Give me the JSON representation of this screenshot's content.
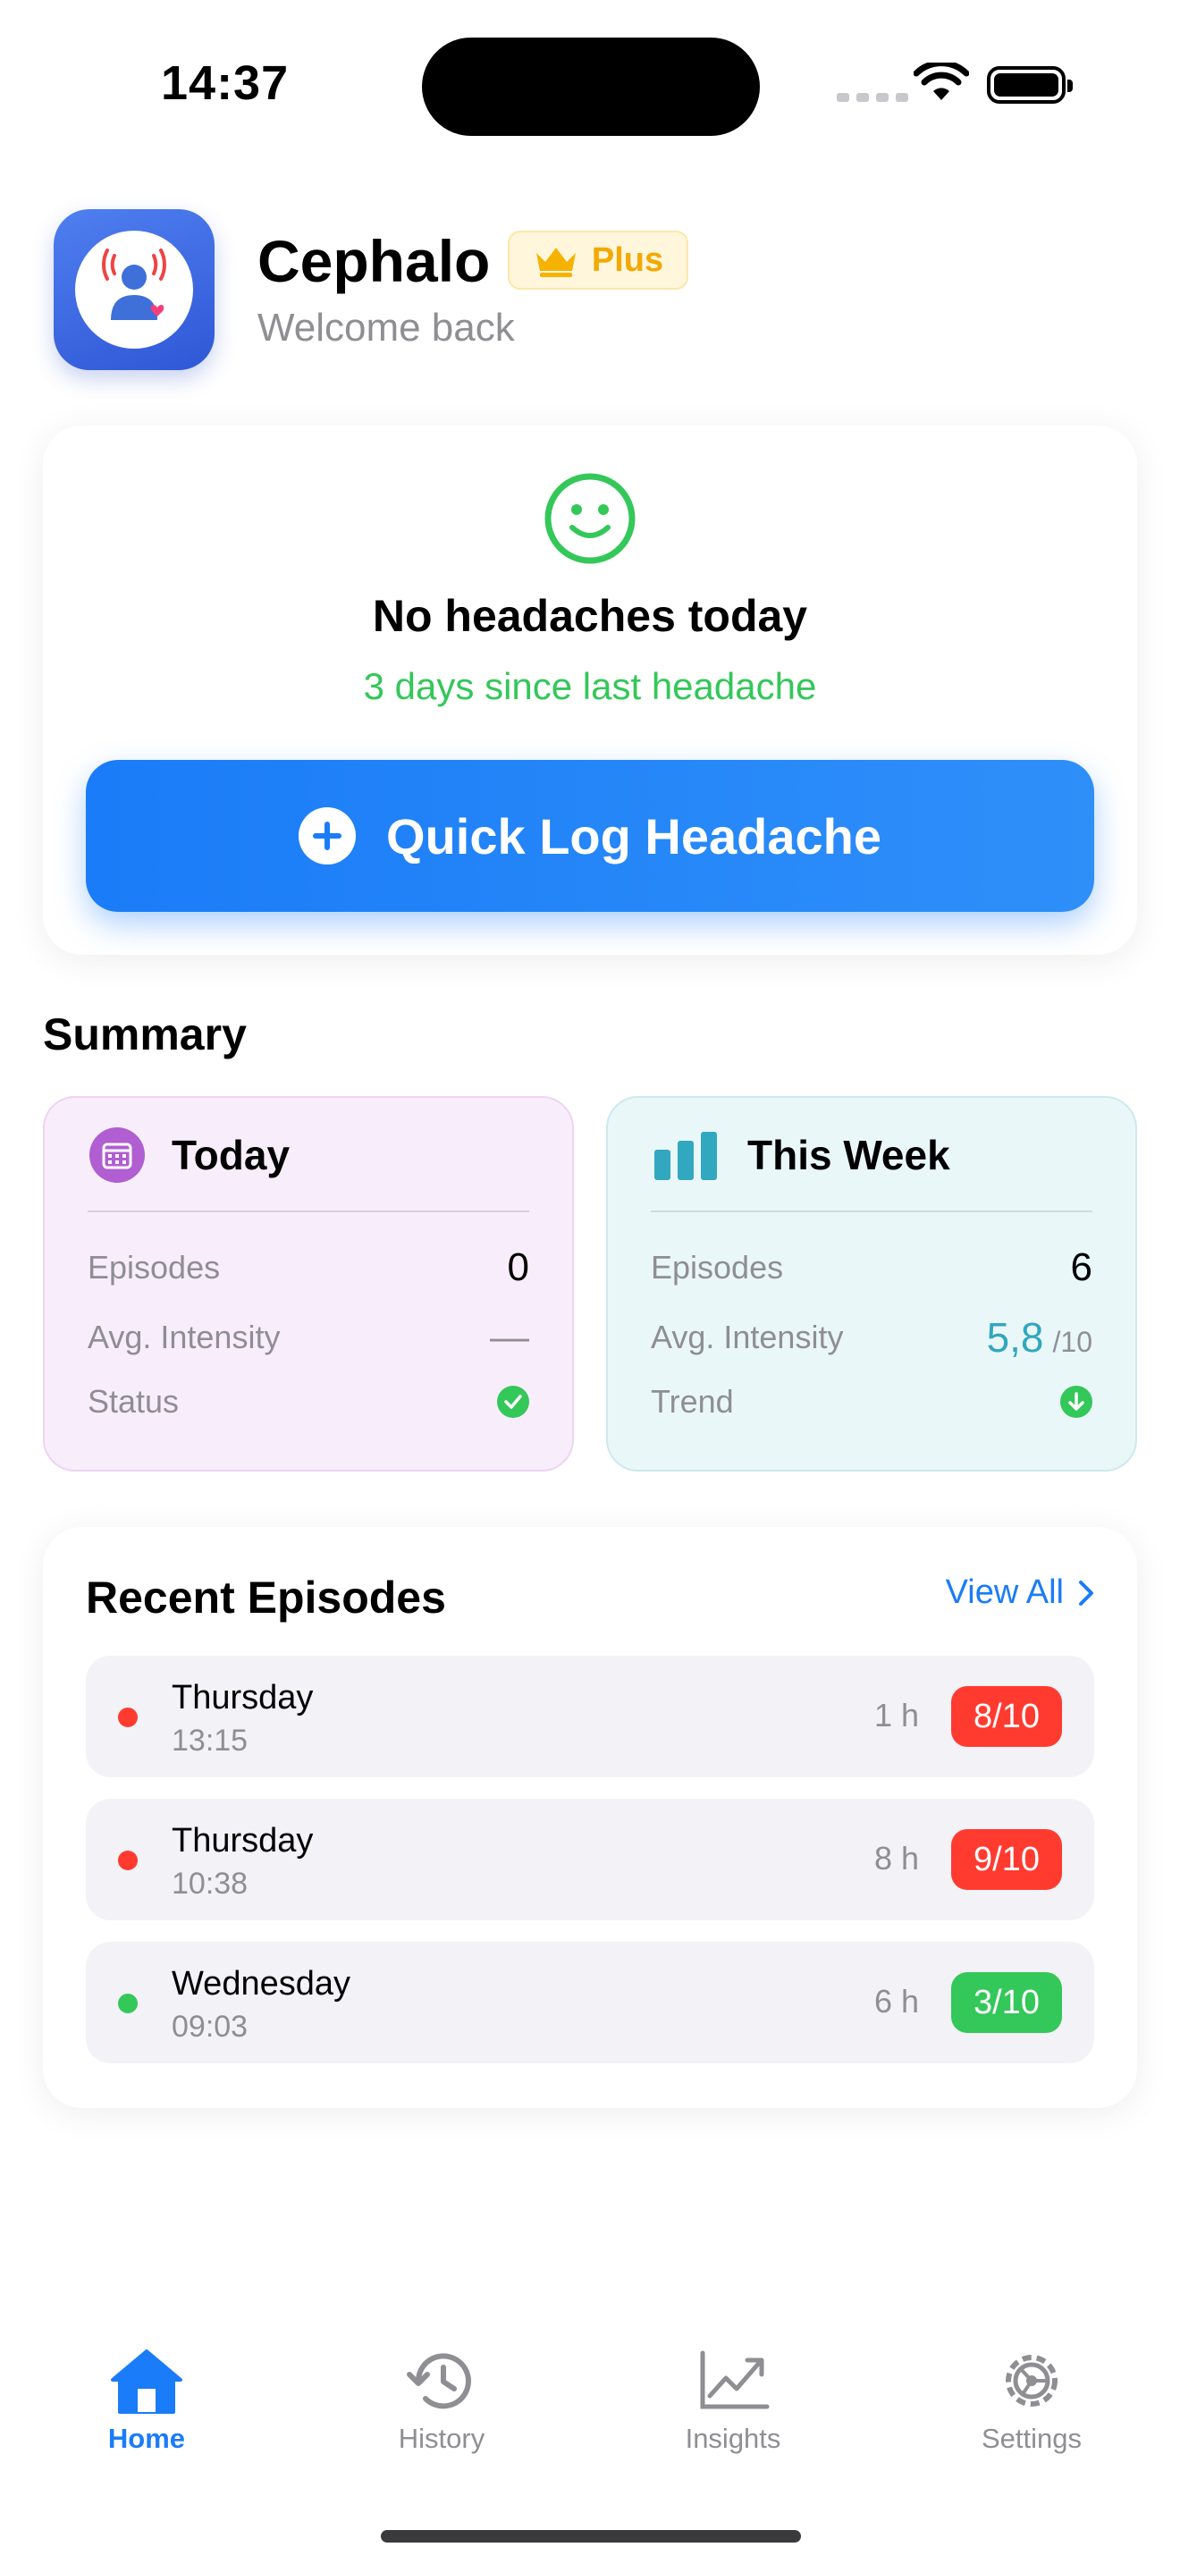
{
  "status_bar": {
    "time": "14:37"
  },
  "header": {
    "app_name": "Cephalo",
    "badge": "Plus",
    "subtitle": "Welcome back"
  },
  "today_status": {
    "icon": "smile-icon",
    "title": "No headaches today",
    "subtitle": "3 days since last headache",
    "quick_log_label": "Quick Log Headache"
  },
  "summary": {
    "title": "Summary",
    "today": {
      "title": "Today",
      "icon": "calendar-icon",
      "rows": [
        {
          "label": "Episodes",
          "value": "0"
        },
        {
          "label": "Avg. Intensity",
          "value": "—"
        },
        {
          "label": "Status",
          "value_icon": "checkmark-icon"
        }
      ]
    },
    "week": {
      "title": "This Week",
      "icon": "bar-chart-icon",
      "rows": [
        {
          "label": "Episodes",
          "value": "6"
        },
        {
          "label": "Avg. Intensity",
          "value": "5,8",
          "unit": "/10"
        },
        {
          "label": "Trend",
          "value_icon": "arrow-down-icon"
        }
      ]
    }
  },
  "recent": {
    "title": "Recent Episodes",
    "view_all": "View All",
    "episodes": [
      {
        "day": "Thursday",
        "time": "13:15",
        "duration": "1 h",
        "score": "8/10",
        "color": "#ff3b30"
      },
      {
        "day": "Thursday",
        "time": "10:38",
        "duration": "8 h",
        "score": "9/10",
        "color": "#ff3b30"
      },
      {
        "day": "Wednesday",
        "time": "09:03",
        "duration": "6 h",
        "score": "3/10",
        "color": "#34c759"
      }
    ]
  },
  "tabs": [
    {
      "label": "Home",
      "icon": "home-icon",
      "active": true
    },
    {
      "label": "History",
      "icon": "history-icon",
      "active": false
    },
    {
      "label": "Insights",
      "icon": "insights-icon",
      "active": false
    },
    {
      "label": "Settings",
      "icon": "settings-icon",
      "active": false
    }
  ],
  "colors": {
    "accent": "#1a7cf8",
    "success": "#34c759",
    "danger": "#ff3b30",
    "teal": "#31a8bf",
    "purple": "#b05ed1"
  }
}
